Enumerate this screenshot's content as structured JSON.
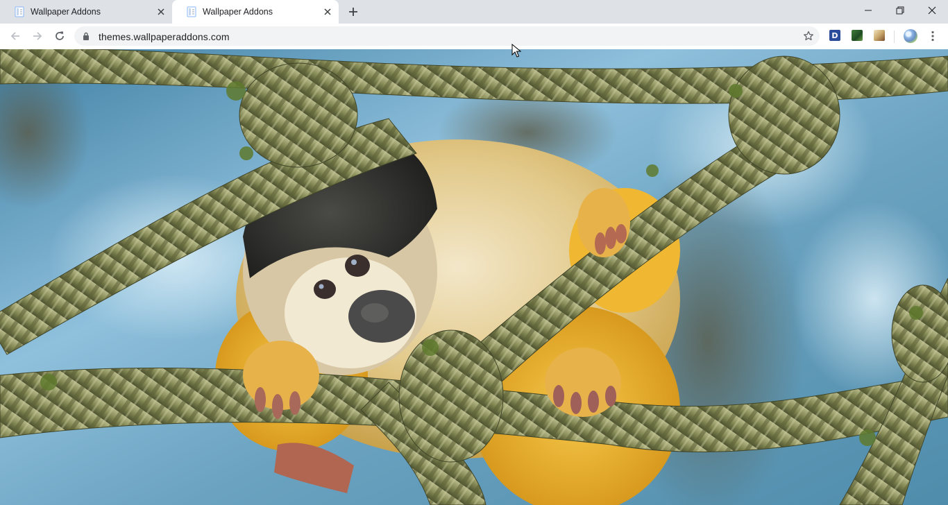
{
  "browser": {
    "tabs": [
      {
        "title": "Wallpaper Addons",
        "active": false
      },
      {
        "title": "Wallpaper Addons",
        "active": true
      }
    ],
    "address_bar": {
      "url": "themes.wallpaperaddons.com"
    },
    "extensions": [
      {
        "icon": "d-extension-icon",
        "letter": "D",
        "color": "#2b4b9b"
      },
      {
        "icon": "green-extension-icon",
        "color": "#2f6b2f"
      },
      {
        "icon": "photo-extension-icon",
        "color": "#c9a86a"
      }
    ]
  },
  "page": {
    "wallpaper": {
      "subject": "squirrel-monkey-on-ropes-photo"
    }
  },
  "colors": {
    "titlebar": "#dee1e6",
    "toolbar": "#ffffff",
    "omnibox": "#f1f3f4",
    "rope": "#8a8f5a",
    "sky": "#7fb6d6"
  }
}
